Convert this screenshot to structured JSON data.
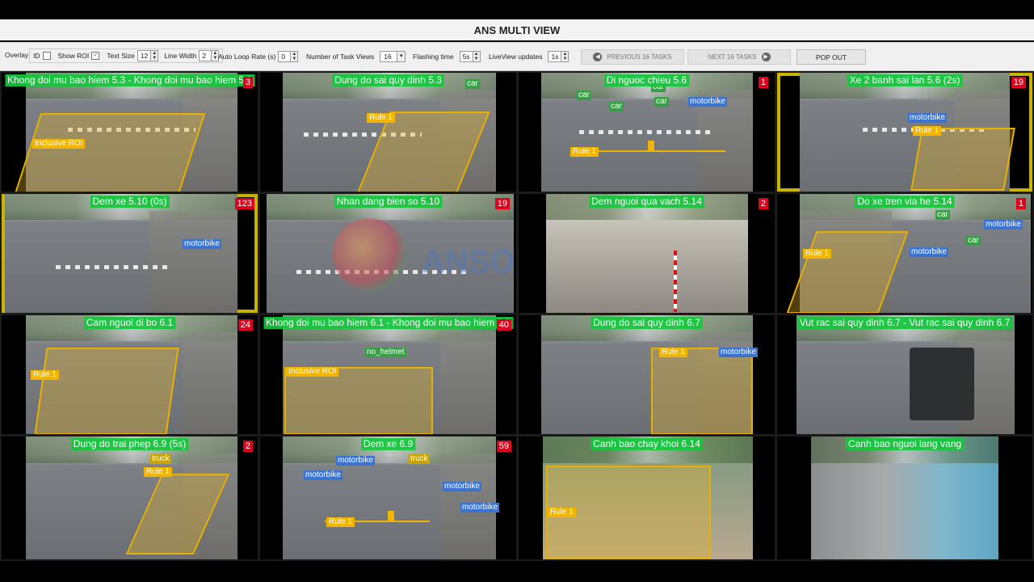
{
  "window": {
    "title": "ANS MULTI VIEW"
  },
  "toolbar": {
    "overlay_label": "Overlay",
    "id_label": "ID",
    "id_checked": false,
    "show_roi_label": "Show ROI",
    "show_roi_checked": true,
    "text_size_label": "Text Size",
    "text_size_value": "12",
    "line_width_label": "Line Width",
    "line_width_value": "2",
    "auto_loop_label": "Auto Loop Rate (s)",
    "auto_loop_value": "0",
    "num_task_views_label": "Number of Task Views",
    "num_task_views_value": "16",
    "flashing_time_label": "Flashing time",
    "flashing_time_value": "5s",
    "liveview_label": "LiveView updates",
    "liveview_value": "1s",
    "previous_label": "PREVIOUS 16 TASKS",
    "next_label": "NEXT 16 TASKS",
    "popout_label": "POP OUT"
  },
  "colors": {
    "title_bg": "#12c83c",
    "count_bg": "#e0001b",
    "roi": "#e8b000",
    "highlight": "#c8b400",
    "detection": "#3b74d0"
  },
  "views": [
    {
      "title": "Khong doi mu bao hiem 5.3 - Khong doi mu bao hiem 5.3",
      "count": "3",
      "highlighted": false,
      "labels": {
        "roi": "Inclusive ROI"
      }
    },
    {
      "title": "Dung do sai quy dinh 5.3",
      "count": "",
      "highlighted": false,
      "labels": {
        "roi": "Rule 1",
        "d1": "car"
      }
    },
    {
      "title": "Di nguoc chieu 5.6",
      "count": "1",
      "highlighted": false,
      "labels": {
        "rule": "Rule 1",
        "d1": "car",
        "d2": "car",
        "d3": "car",
        "d4": "motorbike",
        "d5": "car"
      }
    },
    {
      "title": "Xe 2 banh sai lan 5.6 (2s)",
      "count": "19",
      "highlighted": true,
      "labels": {
        "roi": "Rule 1",
        "d1": "motorbike"
      }
    },
    {
      "title": "Dem xe 5.10 (0s)",
      "count": "123",
      "highlighted": true,
      "labels": {
        "d1": "motorbike"
      }
    },
    {
      "title": "Nhan dang bien so 5.10",
      "count": "19",
      "highlighted": false,
      "watermark": "ANSOX",
      "labels": {}
    },
    {
      "title": "Dem nguoi qua vach 5.14",
      "count": "2",
      "highlighted": false,
      "labels": {}
    },
    {
      "title": "Do xe tren via he 5.14",
      "count": "1",
      "highlighted": false,
      "labels": {
        "roi": "Rule 1",
        "d1": "motorbike",
        "d2": "motorbike",
        "d3": "car",
        "d4": "car"
      }
    },
    {
      "title": "Cam nguoi di bo 6.1",
      "count": "24",
      "highlighted": false,
      "labels": {
        "roi": "Rule 1"
      }
    },
    {
      "title": "Khong doi mu bao hiem 6.1 - Khong doi mu bao hiem 6.1",
      "count": "40",
      "highlighted": false,
      "labels": {
        "roi": "Inclusive ROI",
        "d1": "no_helmet"
      }
    },
    {
      "title": "Dung do sai quy dinh 6.7",
      "count": "",
      "highlighted": false,
      "labels": {
        "roi": "Rule 1",
        "d1": "motorbike"
      }
    },
    {
      "title": "Vut rac sai quy dinh 6.7 - Vut rac sai quy dinh 6.7",
      "count": "",
      "highlighted": false,
      "labels": {}
    },
    {
      "title": "Dung do trai phep 6.9 (5s)",
      "count": "2",
      "highlighted": false,
      "labels": {
        "roi": "Rule 1",
        "d1": "truck"
      }
    },
    {
      "title": "Dem xe 6.9",
      "count": "59",
      "highlighted": false,
      "labels": {
        "rule": "Rule 1",
        "d1": "motorbike",
        "d2": "motorbike",
        "d3": "truck",
        "d4": "motorbike",
        "d5": "motorbike"
      }
    },
    {
      "title": "Canh bao chay khoi 6.14",
      "count": "",
      "highlighted": false,
      "labels": {
        "roi": "Rule 1"
      }
    },
    {
      "title": "Canh bao nguoi lang vang",
      "count": "",
      "highlighted": false,
      "labels": {}
    }
  ]
}
